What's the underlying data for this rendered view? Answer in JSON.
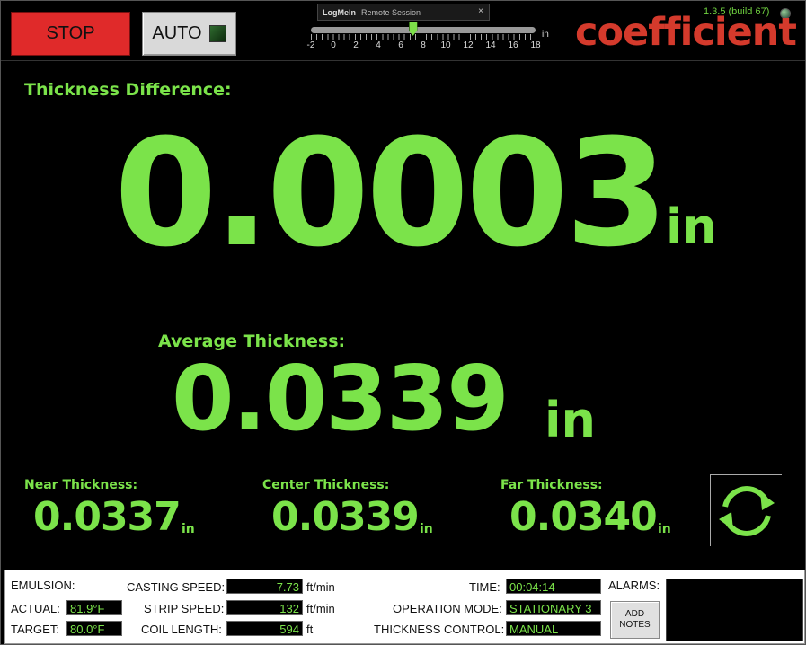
{
  "toolbar": {
    "stop_label": "STOP",
    "auto_label": "AUTO"
  },
  "remote": {
    "app": "LogMeIn",
    "session": "Remote Session",
    "close": "×"
  },
  "scale": {
    "ticks": [
      "-2",
      "0",
      "2",
      "4",
      "6",
      "8",
      "10",
      "12",
      "14",
      "16",
      "18"
    ],
    "unit": "in",
    "value": 7
  },
  "version": "1.3.5 (build 67)",
  "brand": "coefficient",
  "thickness_diff": {
    "label": "Thickness Difference:",
    "value": "0.0003",
    "unit": "in"
  },
  "avg": {
    "label": "Average Thickness:",
    "value": "0.0339",
    "unit": "in"
  },
  "near": {
    "label": "Near Thickness:",
    "value": "0.0337",
    "unit": "in"
  },
  "center": {
    "label": "Center Thickness:",
    "value": "0.0339",
    "unit": "in"
  },
  "far": {
    "label": "Far Thickness:",
    "value": "0.0340",
    "unit": "in"
  },
  "status": {
    "emulsion": "EMULSION:",
    "actual_label": "ACTUAL:",
    "actual": "81.9°F",
    "target_label": "TARGET:",
    "target": "80.0°F",
    "casting_label": "CASTING SPEED:",
    "casting": "7.73",
    "casting_unit": "ft/min",
    "strip_label": "STRIP SPEED:",
    "strip": "132",
    "strip_unit": "ft/min",
    "coil_label": "COIL LENGTH:",
    "coil": "594",
    "coil_unit": "ft",
    "time_label": "TIME:",
    "time": "00:04:14",
    "mode_label": "OPERATION MODE:",
    "mode": "STATIONARY 3",
    "control_label": "THICKNESS CONTROL:",
    "control": "MANUAL",
    "alarms_label": "ALARMS:",
    "notes_line1": "ADD",
    "notes_line2": "NOTES"
  },
  "colors": {
    "accent": "#7be34a",
    "stop": "#e02a2a",
    "brand": "#d43a2c"
  }
}
